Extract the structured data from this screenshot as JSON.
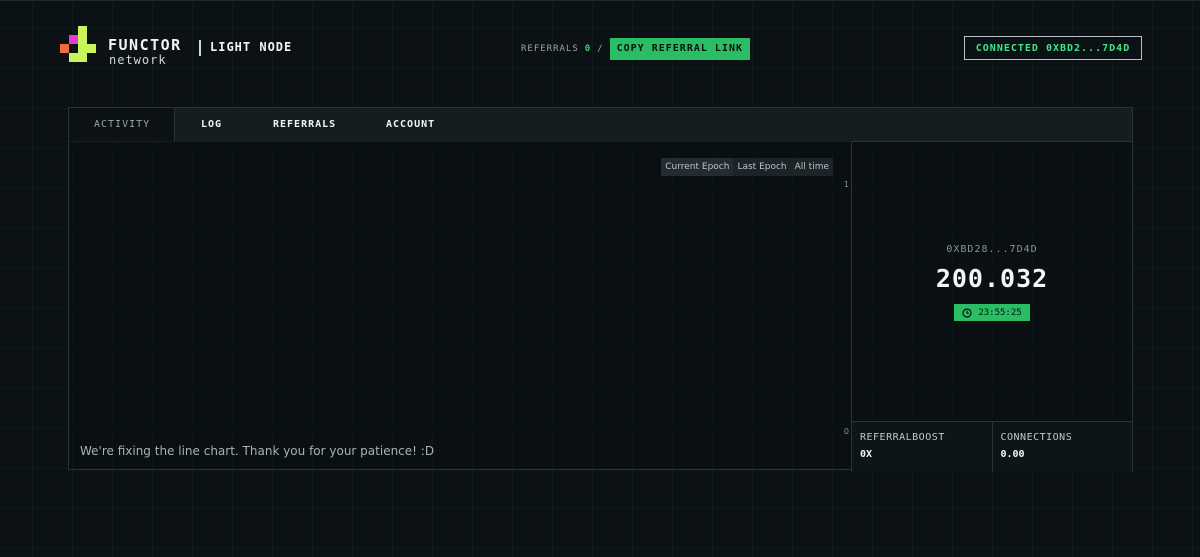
{
  "brand": {
    "title": "FUNCTOR",
    "subtitle": "network",
    "node_label": "LIGHT NODE"
  },
  "header": {
    "referrals_label": "REFERRALS",
    "referrals_count": "0",
    "separator": "/",
    "copy_link_label": "COPY REFERRAL LINK",
    "connected_label": "CONNECTED 0XBD2...7D4D"
  },
  "tabs": [
    {
      "label": "ACTIVITY",
      "active": true
    },
    {
      "label": "LOG"
    },
    {
      "label": "REFERRALS"
    },
    {
      "label": "ACCOUNT"
    }
  ],
  "chart": {
    "ranges": [
      "Current Epoch",
      "Last Epoch",
      "All time"
    ],
    "y_tick_top": "1",
    "y_tick_bottom": "0",
    "notice": "We're fixing the line chart. Thank you for your patience! :D"
  },
  "summary": {
    "wallet": "0XBD28...7D4D",
    "balance": "200.032",
    "timer": "23:55:25",
    "stats": [
      {
        "label": "REFERRALBOOST",
        "value": "0X"
      },
      {
        "label": "CONNECTIONS",
        "value": "0.00"
      }
    ]
  },
  "colors": {
    "accent": "#2bbd63",
    "connected_text": "#3ee68b",
    "background": "#0b1114"
  },
  "icons": {
    "logo": "functor-logo-icon",
    "timer": "clock-icon"
  }
}
